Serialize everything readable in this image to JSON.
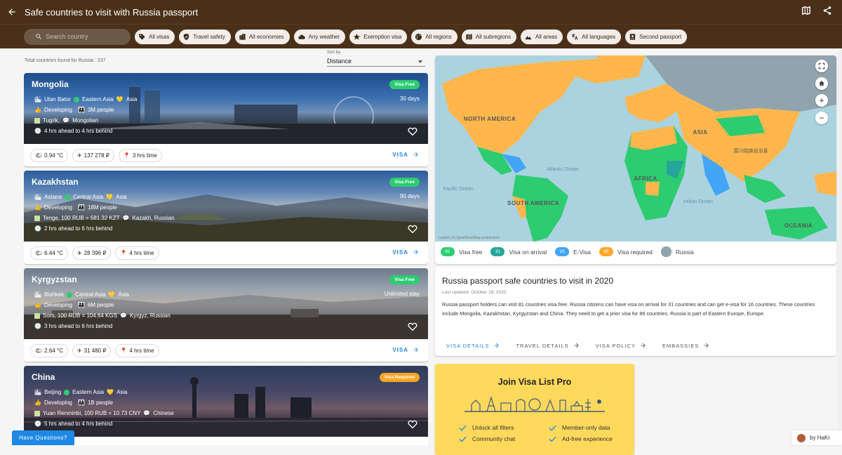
{
  "header": {
    "title": "Safe countries to visit with Russia passport"
  },
  "filters": {
    "search_placeholder": "Search country",
    "chips": [
      "All visas",
      "Travel safety",
      "All economies",
      "Any weather",
      "Exemption visa",
      "All regions",
      "All subregions",
      "All areas",
      "All languages",
      "Second passport"
    ]
  },
  "list": {
    "total": "Total countries found for Russia : 237",
    "sort_label": "Sort by",
    "sort_value": "Distance",
    "visa_link": "VISA",
    "countries": [
      {
        "name": "Mongolia",
        "badge": "Visa Free",
        "badge_color": "#2ecc71",
        "stay": "30 days",
        "capital": "Ulan Bator",
        "subregion": "Eastern Asia",
        "continent": "Asia",
        "economy": "Developing",
        "population": "3M people",
        "currency": "Tugrik,",
        "language": "Mongolian",
        "timezone": "4 hrs ahead to 4 hrs behind",
        "temp": "0.94 °C",
        "cost": "137 278 ₽",
        "flight": "3 hrs time"
      },
      {
        "name": "Kazakhstan",
        "badge": "Visa Free",
        "badge_color": "#2ecc71",
        "stay": "90 days",
        "capital": "Astana",
        "subregion": "Central Asia",
        "continent": "Asia",
        "economy": "Developing",
        "population": "18M people",
        "currency": "Tenge, 100 RUB = 581.32 KZT",
        "language": "Kazakh, Russian",
        "timezone": "2 hrs ahead to 6 hrs behind",
        "temp": "6.44 °C",
        "cost": "28 396 ₽",
        "flight": "4 hrs time"
      },
      {
        "name": "Kyrgyzstan",
        "badge": "Visa Free",
        "badge_color": "#2ecc71",
        "stay": "Unlimited stay",
        "capital": "Bishkek",
        "subregion": "Central Asia",
        "continent": "Asia",
        "economy": "Developing",
        "population": "6M people",
        "currency": "Som, 100 RUB = 104.64 KGS",
        "language": "Kyrgyz, Russian",
        "timezone": "3 hrs ahead to 6 hrs behind",
        "temp": "2.64 °C",
        "cost": "31 480 ₽",
        "flight": "4 hrs time"
      },
      {
        "name": "China",
        "badge": "Visa Required",
        "badge_color": "#f5a623",
        "stay": "",
        "capital": "Beijing",
        "subregion": "Eastern Asia",
        "continent": "Asia",
        "economy": "Developing",
        "population": "1B people",
        "currency": "Yuan Renminbi, 100 RUB = 10.73 CNY",
        "language": "Chinese",
        "timezone": "5 hrs ahead to 4 hrs behind",
        "temp": "",
        "cost": "",
        "flight": ""
      }
    ]
  },
  "map": {
    "labels": [
      "NORTH AMERICA",
      "SOUTH AMERICA",
      "AFRICA",
      "ASIA",
      "OCEANIA",
      "Atlantic Ocean",
      "Pacific Ocean",
      "Indian Ocean"
    ],
    "cjk_label": "富川瑶族自治县",
    "attribution": "Leaflet | © OpenStreetMap contributors",
    "legend": [
      {
        "count": "81",
        "label": "Visa free",
        "color": "#2ecc71"
      },
      {
        "count": "31",
        "label": "Visa on arrival",
        "color": "#26a69a"
      },
      {
        "count": "16",
        "label": "E-Visa",
        "color": "#42a5f5"
      },
      {
        "count": "86",
        "label": "Visa required",
        "color": "#ffa726"
      },
      {
        "count": "",
        "label": "Russia",
        "color": "#90a4ae"
      }
    ]
  },
  "info": {
    "title": "Russia passport safe countries to visit in 2020",
    "updated": "Last updated: October 18, 2020",
    "body": "Russia passport holders can visit 81 countries visa free. Russia citizens can have visa on arrival for 31 countries and can get e-visa for 16 countries. These countries include Mongolia, Kazakhstan, Kyrgyzstan and China. They need to get a prior visa for 86 countries. Russia is part of Eastern Europe, Europe.",
    "links": [
      "VISA DETAILS",
      "TRAVEL DETAILS",
      "VISA POLICY",
      "EMBASSIES"
    ]
  },
  "pro": {
    "title": "Join Visa List Pro",
    "features": [
      "Unlock all filters",
      "Member-only data",
      "Community chat",
      "Ad-free experience"
    ]
  },
  "help": {
    "button": "Have Questions?"
  },
  "credit": {
    "text": "by HaKr"
  }
}
